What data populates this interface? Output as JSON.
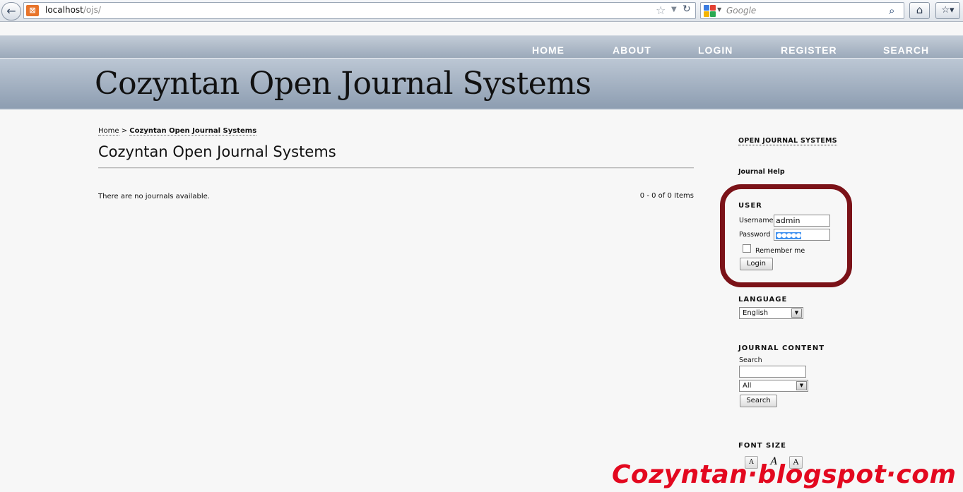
{
  "browser": {
    "back_glyph": "←",
    "url_host": "localhost",
    "url_path": "/ojs/",
    "search_engine": "Google",
    "search_placeholder": "Google",
    "home_glyph": "⌂",
    "bookmarks_glyph": "☆▾"
  },
  "nav": {
    "items": [
      "HOME",
      "ABOUT",
      "LOGIN",
      "REGISTER",
      "SEARCH"
    ]
  },
  "header": {
    "title": "Cozyntan Open Journal Systems"
  },
  "breadcrumb": {
    "home": "Home",
    "separator": ">",
    "current": "Cozyntan Open Journal Systems"
  },
  "main": {
    "page_title": "Cozyntan Open Journal Systems",
    "no_journals": "There are no journals available.",
    "item_count": "0 - 0 of 0 Items"
  },
  "sidebar": {
    "ojs_link": "OPEN JOURNAL SYSTEMS",
    "journal_help": "Journal Help",
    "user": {
      "title": "USER",
      "username_label": "Username",
      "username_value": "admin",
      "password_label": "Password",
      "password_value": "●●●●●",
      "remember_label": "Remember me",
      "login_button": "Login"
    },
    "language": {
      "title": "LANGUAGE",
      "selected": "English"
    },
    "journal_content": {
      "title": "JOURNAL CONTENT",
      "search_label": "Search",
      "search_value": "",
      "scope_selected": "All",
      "search_button": "Search"
    },
    "font_size": {
      "title": "FONT SIZE",
      "small": "A",
      "default": "A",
      "large": "A"
    }
  },
  "watermark": "Cozyntan·blogspot·com",
  "colors": {
    "highlight_ring": "#7b1218",
    "watermark": "#e3081f",
    "nav_text": "#ffffff"
  }
}
